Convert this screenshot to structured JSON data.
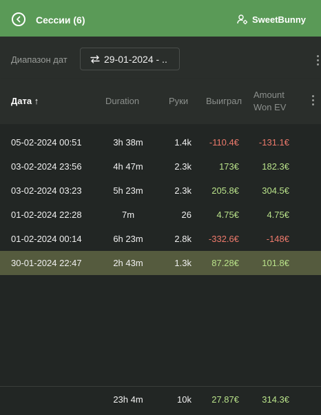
{
  "header": {
    "title": "Сессии (6)",
    "user_name": "SweetBunny"
  },
  "filter": {
    "label": "Диапазон дат",
    "date_value": "29-01-2024 - .."
  },
  "table": {
    "columns": {
      "date": "Дата",
      "duration": "Duration",
      "hands": "Руки",
      "won": "Выиграл",
      "ev_line1": "Amount",
      "ev_line2": "Won EV"
    },
    "sort_indicator": "↑",
    "rows": [
      {
        "date": "05-02-2024 00:51",
        "duration": "3h 38m",
        "hands": "1.4k",
        "won": "-110.4€",
        "ev": "-131.1€"
      },
      {
        "date": "03-02-2024 23:56",
        "duration": "4h 47m",
        "hands": "2.3k",
        "won": "173€",
        "ev": "182.3€"
      },
      {
        "date": "03-02-2024 03:23",
        "duration": "5h 23m",
        "hands": "2.3k",
        "won": "205.8€",
        "ev": "304.5€"
      },
      {
        "date": "01-02-2024 22:28",
        "duration": "7m",
        "hands": "26",
        "won": "4.75€",
        "ev": "4.75€"
      },
      {
        "date": "01-02-2024 00:14",
        "duration": "6h 23m",
        "hands": "2.8k",
        "won": "-332.6€",
        "ev": "-148€"
      },
      {
        "date": "30-01-2024 22:47",
        "duration": "2h 43m",
        "hands": "1.3k",
        "won": "87.28€",
        "ev": "101.8€"
      }
    ],
    "totals": {
      "duration": "23h 4m",
      "hands": "10k",
      "won": "27.87€",
      "ev": "314.3€"
    }
  },
  "colors": {
    "header_bg": "#5a9a57",
    "positive": "#b9e28a",
    "negative": "#ee7a6c",
    "selected_row": "#555b3e"
  },
  "icons": [
    "back-arrow-icon",
    "user-settings-icon",
    "swap-arrows-icon",
    "kebab-menu-icon"
  ]
}
